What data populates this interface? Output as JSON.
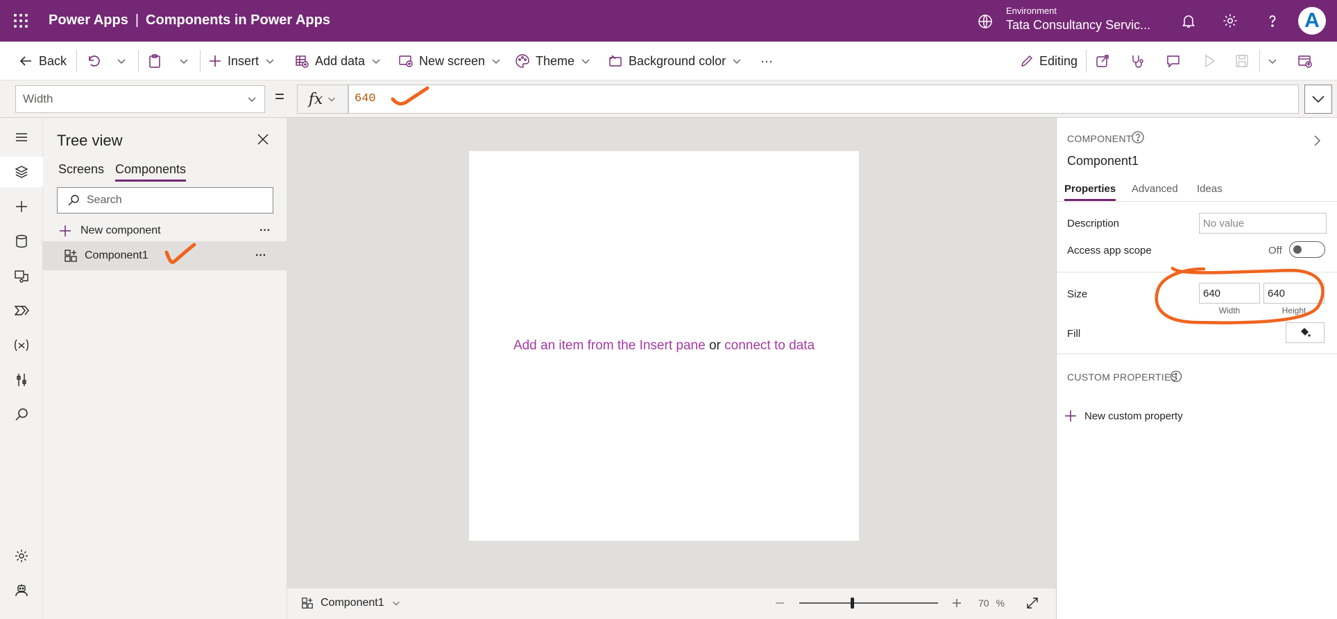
{
  "header": {
    "app_name": "Power Apps",
    "separator": "|",
    "page_title": "Components in Power Apps",
    "environment_label": "Environment",
    "environment_value": "Tata Consultancy Servic...",
    "avatar_initial": "A"
  },
  "toolbar": {
    "back": "Back",
    "insert": "Insert",
    "add_data": "Add data",
    "new_screen": "New screen",
    "theme": "Theme",
    "background_color": "Background color",
    "more": "···",
    "editing": "Editing"
  },
  "formula_bar": {
    "property": "Width",
    "equals": "=",
    "fx": "fx",
    "formula": "640"
  },
  "tree": {
    "title": "Tree view",
    "tabs": [
      "Screens",
      "Components"
    ],
    "active_tab": "Components",
    "search_placeholder": "Search",
    "new_component": "New component",
    "items": [
      {
        "label": "Component1"
      }
    ],
    "more": "···"
  },
  "canvas": {
    "hint_link1": "Add an item from the Insert pane",
    "hint_or": "or",
    "hint_link2": "connect to data"
  },
  "status_bar": {
    "component": "Component1",
    "zoom_value": "70",
    "zoom_unit": "%",
    "zoom_level": 0.37
  },
  "properties": {
    "section_label": "COMPONENT",
    "component_name": "Component1",
    "tabs": [
      "Properties",
      "Advanced",
      "Ideas"
    ],
    "active_tab": "Properties",
    "description_label": "Description",
    "description_placeholder": "No value",
    "access_label": "Access app scope",
    "access_value": "Off",
    "size_label": "Size",
    "width_value": "640",
    "height_value": "640",
    "width_caption": "Width",
    "height_caption": "Height",
    "fill_label": "Fill",
    "custom_props_label": "CUSTOM PROPERTIES",
    "new_custom_property": "New custom property"
  },
  "colors": {
    "brand": "#742774",
    "link": "#a33aa3",
    "annotation": "#f0641e"
  }
}
